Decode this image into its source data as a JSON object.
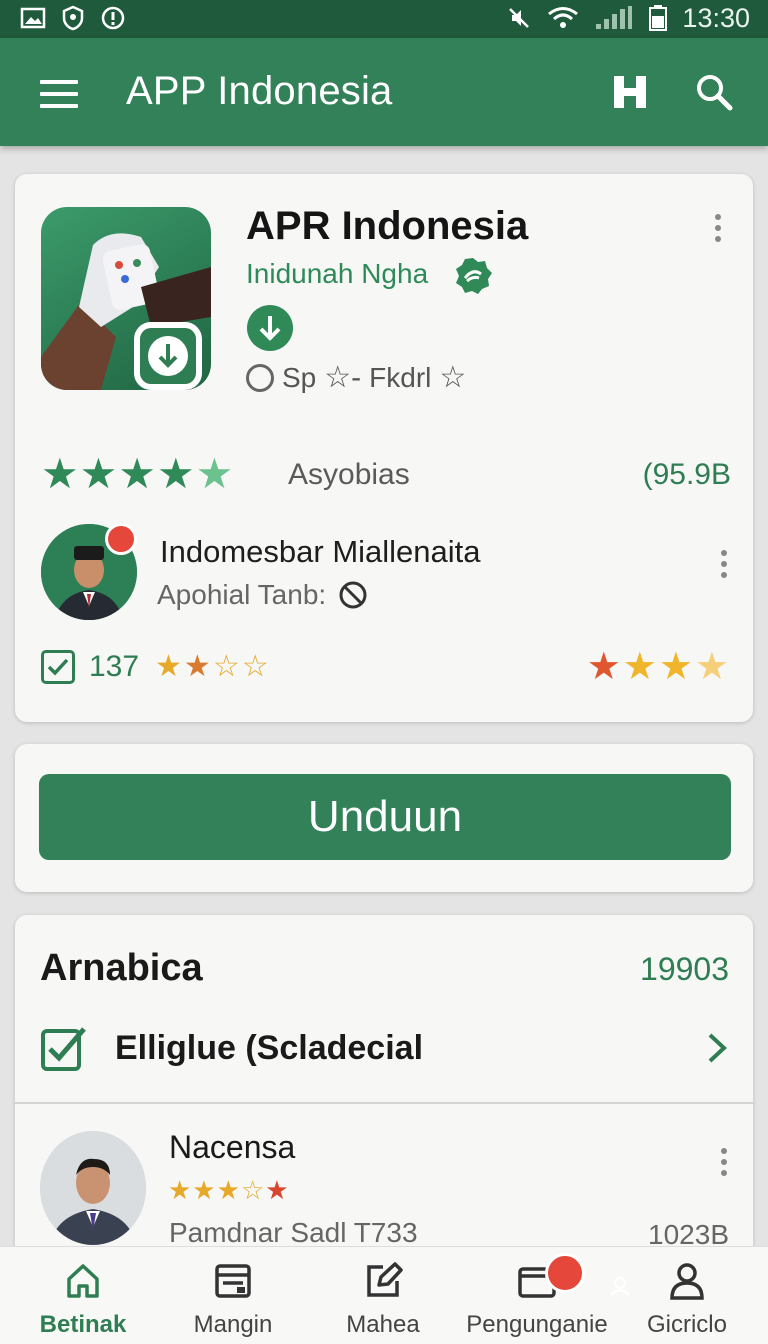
{
  "status_bar": {
    "time": "13:30"
  },
  "app_bar": {
    "title": "APP Indonesia",
    "icons": [
      "menu-icon",
      "bookmark-icon",
      "search-icon"
    ]
  },
  "app_card": {
    "title": "APR Indonesia",
    "developer": "Inidunah Ngha",
    "meta_text": "Sp",
    "meta_text_2": "Fkdrl",
    "rating_label": "Asyobias",
    "rating_count": "(95.9B",
    "reviewer": {
      "name": "Indomesbar Miallenaita",
      "subtitle": "Apohial Tanb:"
    },
    "stat_count": "137",
    "small_rating": 2,
    "gold_rating": 3.5
  },
  "download": {
    "label": "Unduun"
  },
  "section": {
    "title": "Arnabica",
    "count": "19903",
    "item_label": "Elliglue (Scladecial",
    "second": {
      "name": "Nacensa",
      "subtitle": "Pamdnar Sadl T733",
      "size": "1023B"
    }
  },
  "bottom_nav": [
    {
      "label": "Betinak",
      "icon": "home-icon",
      "active": true
    },
    {
      "label": "Mangin",
      "icon": "inbox-icon",
      "active": false
    },
    {
      "label": "Mahea",
      "icon": "edit-icon",
      "active": false
    },
    {
      "label": "Pengunganie",
      "icon": "folder-icon",
      "active": false
    },
    {
      "label": "Gicriclo",
      "icon": "profile-icon",
      "active": false
    }
  ],
  "colors": {
    "primary": "#338158",
    "status_bar": "#1f5a3c",
    "accent_red": "#e5473a",
    "star_gold": "#e6a92a"
  }
}
